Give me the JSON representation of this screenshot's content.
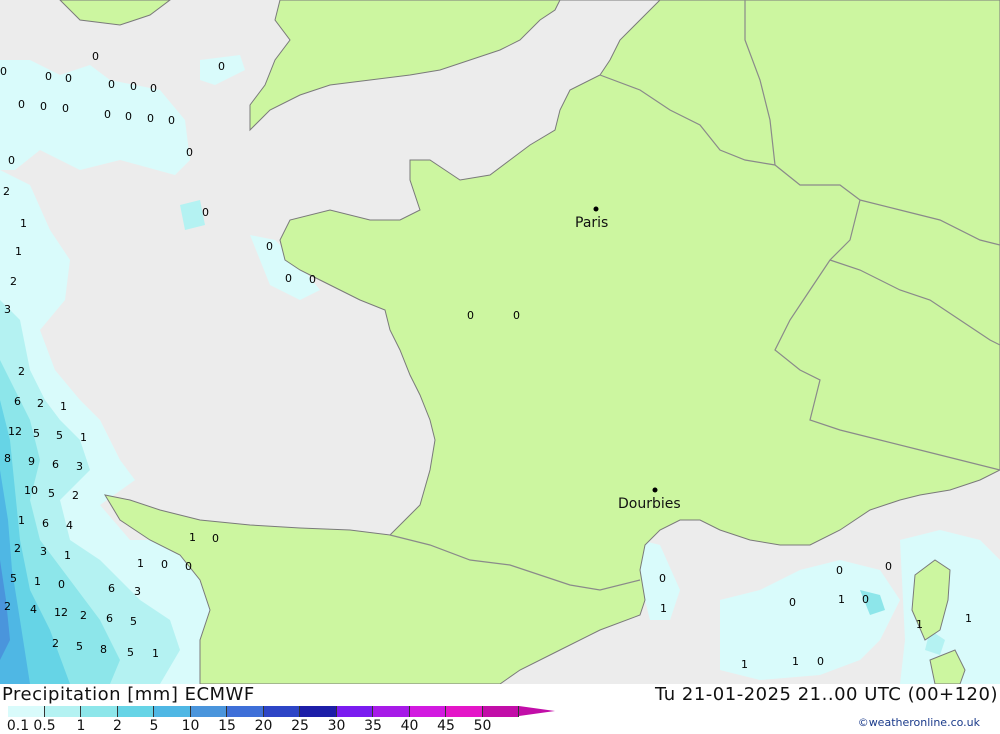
{
  "map": {
    "cities": [
      {
        "name": "Paris"
      },
      {
        "name": "Dourbies"
      }
    ],
    "values": [
      "0",
      "0",
      "0",
      "0",
      "0",
      "0",
      "0",
      "0",
      "0",
      "0",
      "0",
      "0",
      "0",
      "0",
      "0",
      "0",
      "0",
      "0",
      "0",
      "0",
      "0",
      "0",
      "0",
      "2",
      "1",
      "1",
      "2",
      "3",
      "2",
      "6",
      "2",
      "1",
      "12",
      "5",
      "5",
      "1",
      "8",
      "9",
      "6",
      "3",
      "10",
      "5",
      "2",
      "1",
      "6",
      "4",
      "2",
      "3",
      "1",
      "5",
      "1",
      "0",
      "6",
      "3",
      "2",
      "4",
      "12",
      "2",
      "6",
      "5",
      "2",
      "5",
      "8",
      "5",
      "1",
      "1",
      "0",
      "1",
      "0",
      "0",
      "0",
      "1",
      "0",
      "0",
      "0",
      "1",
      "0",
      "1",
      "1",
      "1",
      "1",
      "0"
    ],
    "colors": {
      "sea": "#ececec",
      "land": "#ccf6a0",
      "border": "#8a8a8a",
      "coast": "#7a7a7a"
    }
  },
  "footer": {
    "title": "Precipitation [mm] ECMWF",
    "datetime": "Tu 21-01-2025 21..00 UTC (00+120)",
    "credit": "©weatheronline.co.uk"
  },
  "legend": {
    "labels": [
      "0.1",
      "0.5",
      "1",
      "2",
      "5",
      "10",
      "15",
      "20",
      "25",
      "30",
      "35",
      "40",
      "45",
      "50"
    ],
    "colors": [
      "#d9fbfb",
      "#b4f2f2",
      "#8de6ea",
      "#66d4e6",
      "#4fb7e4",
      "#4a95dc",
      "#3e6fd8",
      "#2d45c6",
      "#1d1ea8",
      "#7a1cf0",
      "#a71be8",
      "#d21ae0",
      "#e416c8",
      "#c20ea8"
    ]
  }
}
